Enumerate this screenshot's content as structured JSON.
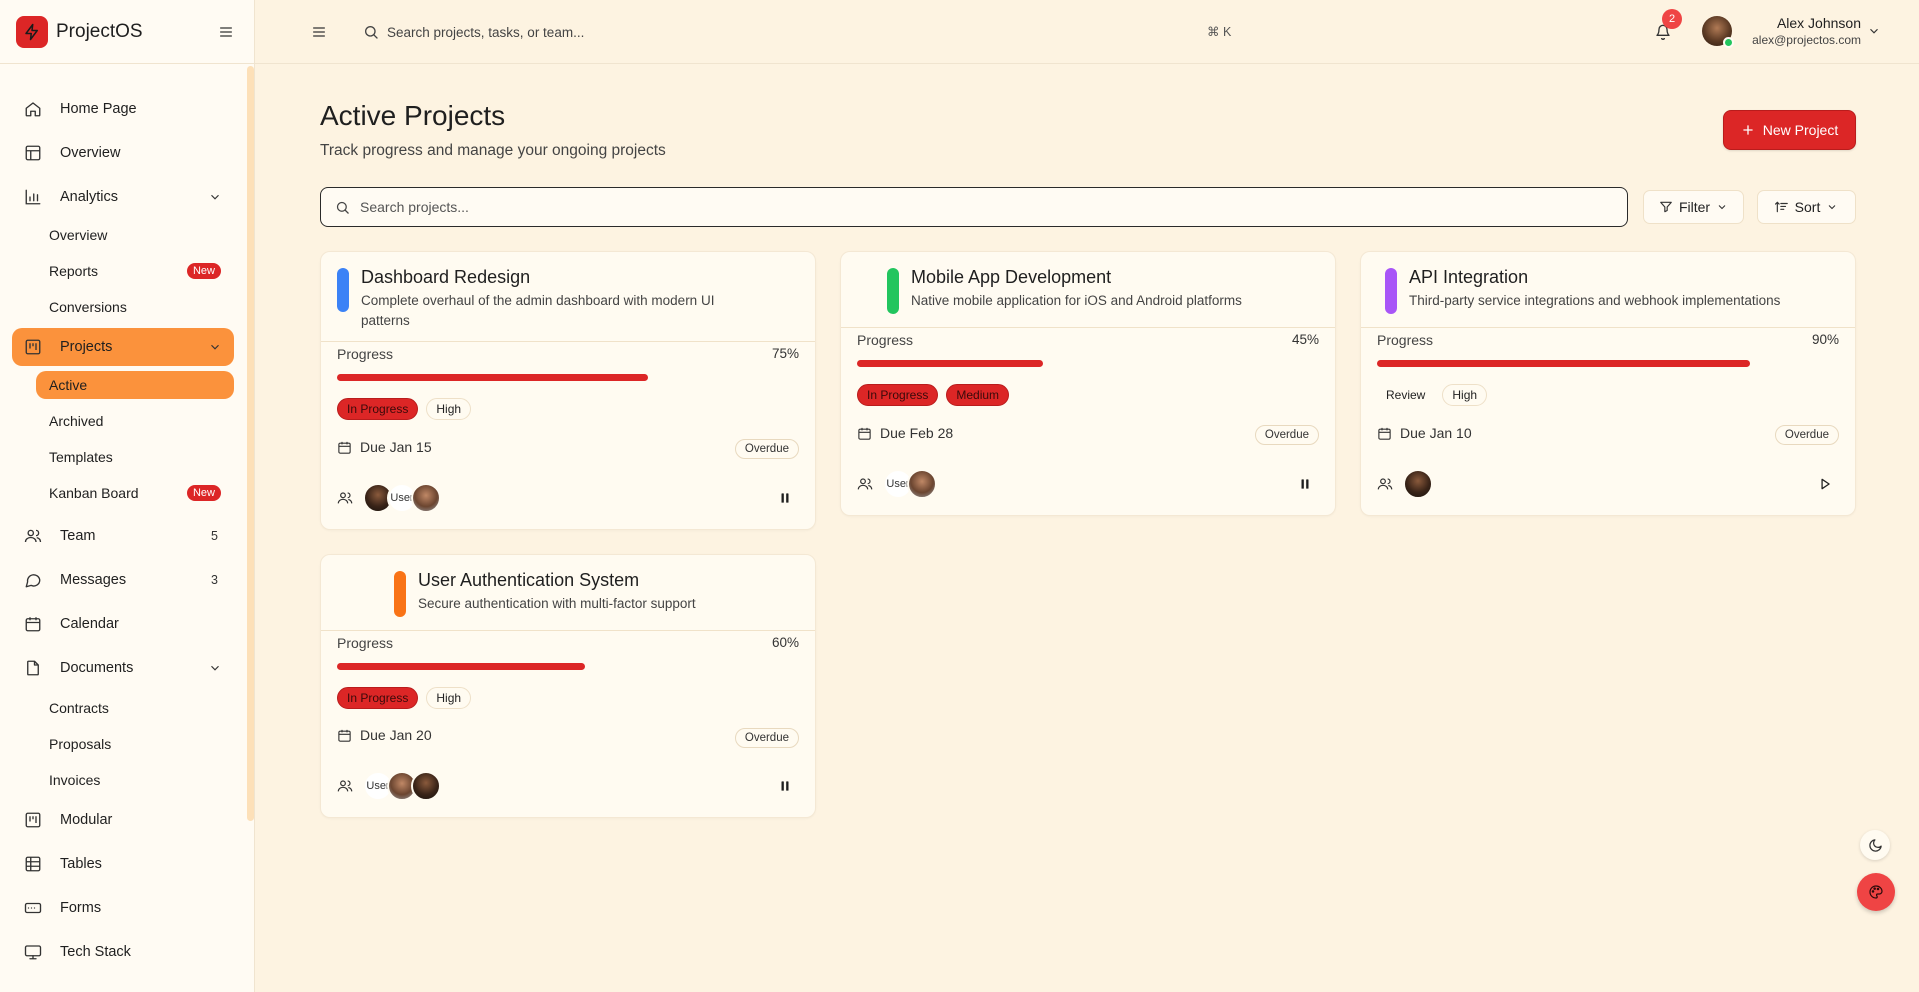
{
  "app": {
    "name": "ProjectOS"
  },
  "sidebar": {
    "items": [
      {
        "label": "Home Page"
      },
      {
        "label": "Overview"
      },
      {
        "label": "Analytics",
        "children": [
          {
            "label": "Overview"
          },
          {
            "label": "Reports",
            "badge": "New"
          },
          {
            "label": "Conversions"
          }
        ]
      },
      {
        "label": "Projects",
        "active": true,
        "children": [
          {
            "label": "Active",
            "active": true
          },
          {
            "label": "Archived"
          },
          {
            "label": "Templates"
          },
          {
            "label": "Kanban Board",
            "badge": "New"
          }
        ]
      },
      {
        "label": "Team",
        "count": "5"
      },
      {
        "label": "Messages",
        "count": "3"
      },
      {
        "label": "Calendar"
      },
      {
        "label": "Documents",
        "children": [
          {
            "label": "Contracts"
          },
          {
            "label": "Proposals"
          },
          {
            "label": "Invoices"
          }
        ]
      },
      {
        "label": "Modular"
      },
      {
        "label": "Tables"
      },
      {
        "label": "Forms"
      },
      {
        "label": "Tech Stack"
      }
    ]
  },
  "topbar": {
    "search_placeholder": "Search projects, tasks, or team...",
    "shortcut": "⌘ K",
    "notifications": "2",
    "user": {
      "name": "Alex Johnson",
      "email": "alex@projectos.com"
    }
  },
  "main": {
    "title": "Active Projects",
    "subtitle": "Track progress and manage your ongoing projects",
    "new_button": "New Project",
    "search_placeholder": "Search projects...",
    "filter_label": "Filter",
    "sort_label": "Sort",
    "progress_label": "Progress",
    "projects": [
      {
        "title": "Dashboard Redesign",
        "description": "Complete overhaul of the admin dashboard with modern UI patterns",
        "accent": "#3b82f6",
        "progress": 75,
        "progress_text": "75%",
        "status": "In Progress",
        "priority": "High",
        "due": "Due Jan 15",
        "due_state": "Overdue",
        "action": "pause"
      },
      {
        "title": "Mobile App Development",
        "description": "Native mobile application for iOS and Android platforms",
        "accent": "#22c55e",
        "progress": 45,
        "progress_text": "45%",
        "status": "In Progress",
        "priority": "Medium",
        "due": "Due Feb 28",
        "due_state": "Overdue",
        "action": "pause"
      },
      {
        "title": "API Integration",
        "description": "Third-party service integrations and webhook implementations",
        "accent": "#a855f7",
        "progress": 90,
        "progress_text": "90%",
        "status": "Review",
        "priority": "High",
        "due": "Due Jan 10",
        "due_state": "Overdue",
        "action": "play"
      },
      {
        "title": "User Authentication System",
        "description": "Secure authentication with multi-factor support",
        "accent": "#f97316",
        "progress": 60,
        "progress_text": "60%",
        "status": "In Progress",
        "priority": "High",
        "due": "Due Jan 20",
        "due_state": "Overdue",
        "action": "pause"
      }
    ],
    "broken_avatar_alt": "User"
  },
  "colors": {
    "accent": "#dc2626",
    "active_nav": "#fb923c",
    "background": "#fdf3e1"
  }
}
